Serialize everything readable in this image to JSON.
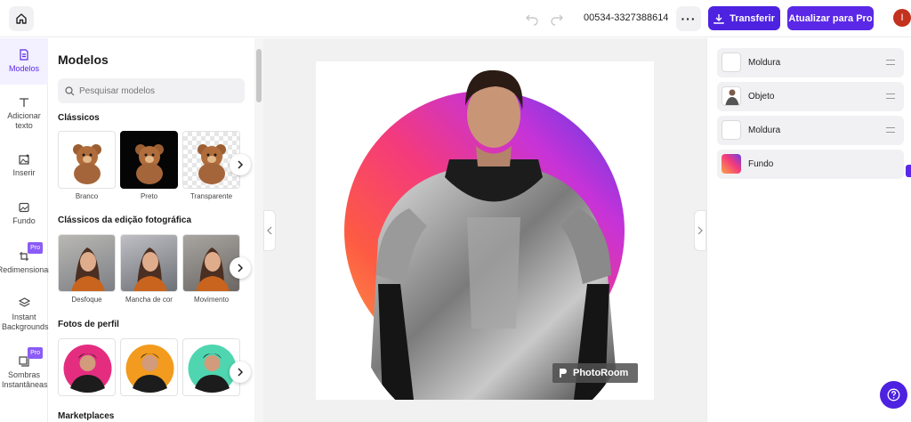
{
  "topbar": {
    "project_id": "00534-3327388614",
    "download_label": "Transferir",
    "upgrade_label": "Atualizar para Pro",
    "avatar_initial": "I"
  },
  "rail": {
    "items": [
      {
        "label": "Modelos",
        "icon": "file-icon",
        "active": true
      },
      {
        "label": "Adicionar texto",
        "icon": "text-icon"
      },
      {
        "label": "Inserir",
        "icon": "insert-image-icon"
      },
      {
        "label": "Fundo",
        "icon": "background-icon"
      },
      {
        "label": "Redimensionar",
        "icon": "crop-icon",
        "badge": "Pro"
      },
      {
        "label": "Instant Backgrounds",
        "icon": "layers-icon"
      },
      {
        "label": "Sombras Instantâneas",
        "icon": "shadow-icon",
        "badge": "Pro"
      }
    ]
  },
  "panel": {
    "title": "Modelos",
    "search_placeholder": "Pesquisar modelos",
    "sections": [
      {
        "title": "Clássicos",
        "items": [
          "Branco",
          "Preto",
          "Transparente"
        ]
      },
      {
        "title": "Clássicos da edição fotográfica",
        "items": [
          "Desfoque",
          "Mancha de cor",
          "Movimento"
        ]
      },
      {
        "title": "Fotos de perfil",
        "items": [
          "",
          "",
          ""
        ]
      },
      {
        "title": "Marketplaces",
        "items": []
      }
    ]
  },
  "canvas": {
    "watermark": "PhotoRoom",
    "colors": {
      "gradient_start": "#fca345",
      "gradient_mid": "#f43a7c",
      "gradient_end": "#4d3ce6"
    }
  },
  "layers": {
    "items": [
      {
        "name": "Moldura"
      },
      {
        "name": "Objeto"
      },
      {
        "name": "Moldura"
      },
      {
        "name": "Fundo"
      }
    ]
  },
  "colors": {
    "accent": "#4d22e0"
  }
}
